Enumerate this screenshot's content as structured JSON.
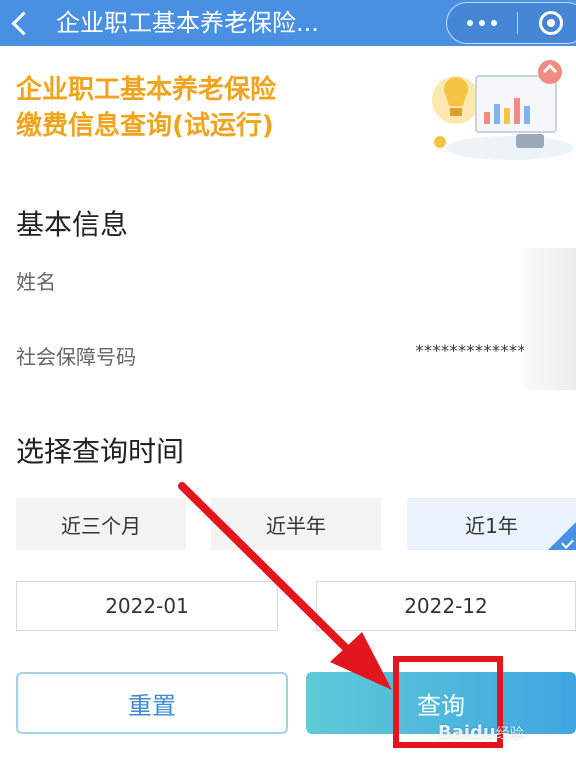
{
  "header": {
    "title": "企业职工基本养老保险..."
  },
  "banner": {
    "title_line1": "企业职工基本养老保险",
    "title_line2": "缴费信息查询(试运行)"
  },
  "basic_info": {
    "heading": "基本信息",
    "name_label": "姓名",
    "ssn_label": "社会保障号码",
    "ssn_value": "*************"
  },
  "query_time": {
    "heading": "选择查询时间",
    "ranges": [
      {
        "label": "近三个月",
        "selected": false
      },
      {
        "label": "近半年",
        "selected": false
      },
      {
        "label": "近1年",
        "selected": true
      }
    ],
    "start_date": "2022-01",
    "end_date": "2022-12"
  },
  "actions": {
    "reset_label": "重置",
    "query_label": "查询"
  },
  "watermark": {
    "brand": "Bai",
    "brand_mid": "du",
    "suffix": "经验"
  },
  "colors": {
    "topbar": "#4a90e2",
    "banner_title": "#f0a31c",
    "annotation_red": "#e3161d",
    "query_gradient_start": "#5fcad8",
    "query_gradient_end": "#3fa6e0"
  }
}
